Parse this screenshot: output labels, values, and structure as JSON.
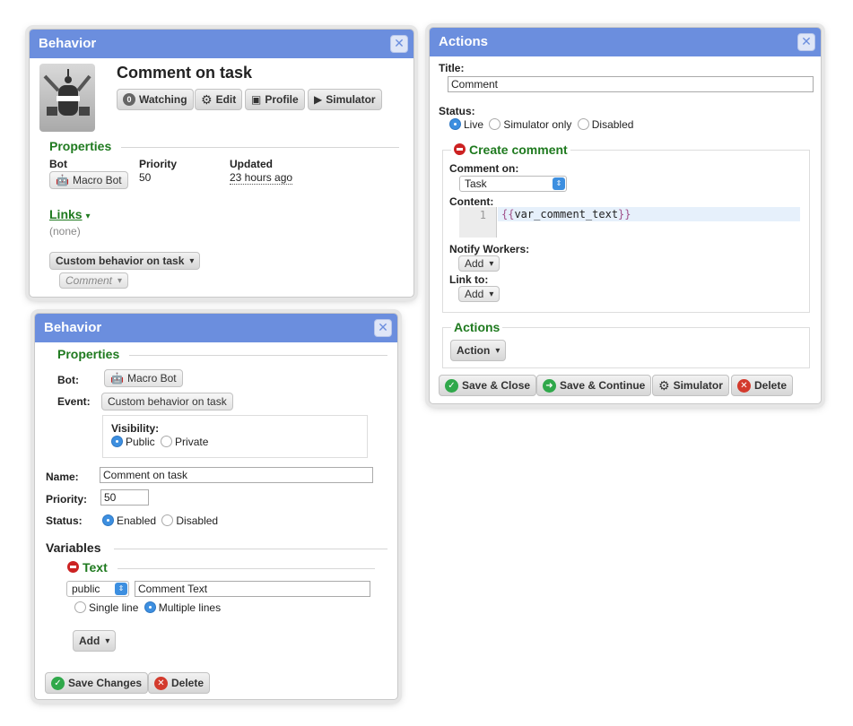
{
  "behavior_top": {
    "title": "Behavior",
    "close": "✕",
    "name": "Comment on task",
    "buttons": {
      "watching_count": "0",
      "watching": "Watching",
      "edit": "Edit",
      "profile": "Profile",
      "simulator": "Simulator"
    },
    "properties_heading": "Properties",
    "bot_label": "Bot",
    "bot_value": "Macro Bot",
    "priority_label": "Priority",
    "priority_value": "50",
    "updated_label": "Updated",
    "updated_value": "23 hours ago",
    "links_label": "Links",
    "links_value": "(none)",
    "custom_behavior": "Custom behavior on task",
    "comment_dropdown": "Comment"
  },
  "behavior_edit": {
    "title": "Behavior",
    "close": "✕",
    "properties_heading": "Properties",
    "bot_label": "Bot:",
    "bot_value": "Macro Bot",
    "event_label": "Event:",
    "event_value": "Custom behavior on task",
    "visibility_label": "Visibility:",
    "visibility_public": "Public",
    "visibility_private": "Private",
    "name_label": "Name:",
    "name_value": "Comment on task",
    "priority_label": "Priority:",
    "priority_value": "50",
    "status_label": "Status:",
    "status_enabled": "Enabled",
    "status_disabled": "Disabled",
    "variables_heading": "Variables",
    "text_heading": "Text",
    "scope_value": "public",
    "var_value": "Comment Text",
    "single_line": "Single line",
    "multiple_lines": "Multiple lines",
    "add_button": "Add",
    "save_button": "Save Changes",
    "delete_button": "Delete"
  },
  "actions": {
    "title": "Actions",
    "close": "✕",
    "title_label": "Title:",
    "title_value": "Comment",
    "status_label": "Status:",
    "status_live": "Live",
    "status_sim": "Simulator only",
    "status_disabled": "Disabled",
    "create_comment": "Create comment",
    "comment_on_label": "Comment on:",
    "comment_on_value": "Task",
    "content_label": "Content:",
    "line_number": "1",
    "code_open": "{{",
    "code_var": "var_comment_text",
    "code_close": "}}",
    "notify_label": "Notify Workers:",
    "notify_add": "Add",
    "link_label": "Link to:",
    "link_add": "Add",
    "actions_heading": "Actions",
    "action_button": "Action",
    "save_close": "Save & Close",
    "save_continue": "Save & Continue",
    "simulator": "Simulator",
    "delete": "Delete"
  },
  "colors": {
    "header": "#6b8ede",
    "green_heading": "#1f7a1f",
    "radio_on": "#3d8fe0"
  }
}
